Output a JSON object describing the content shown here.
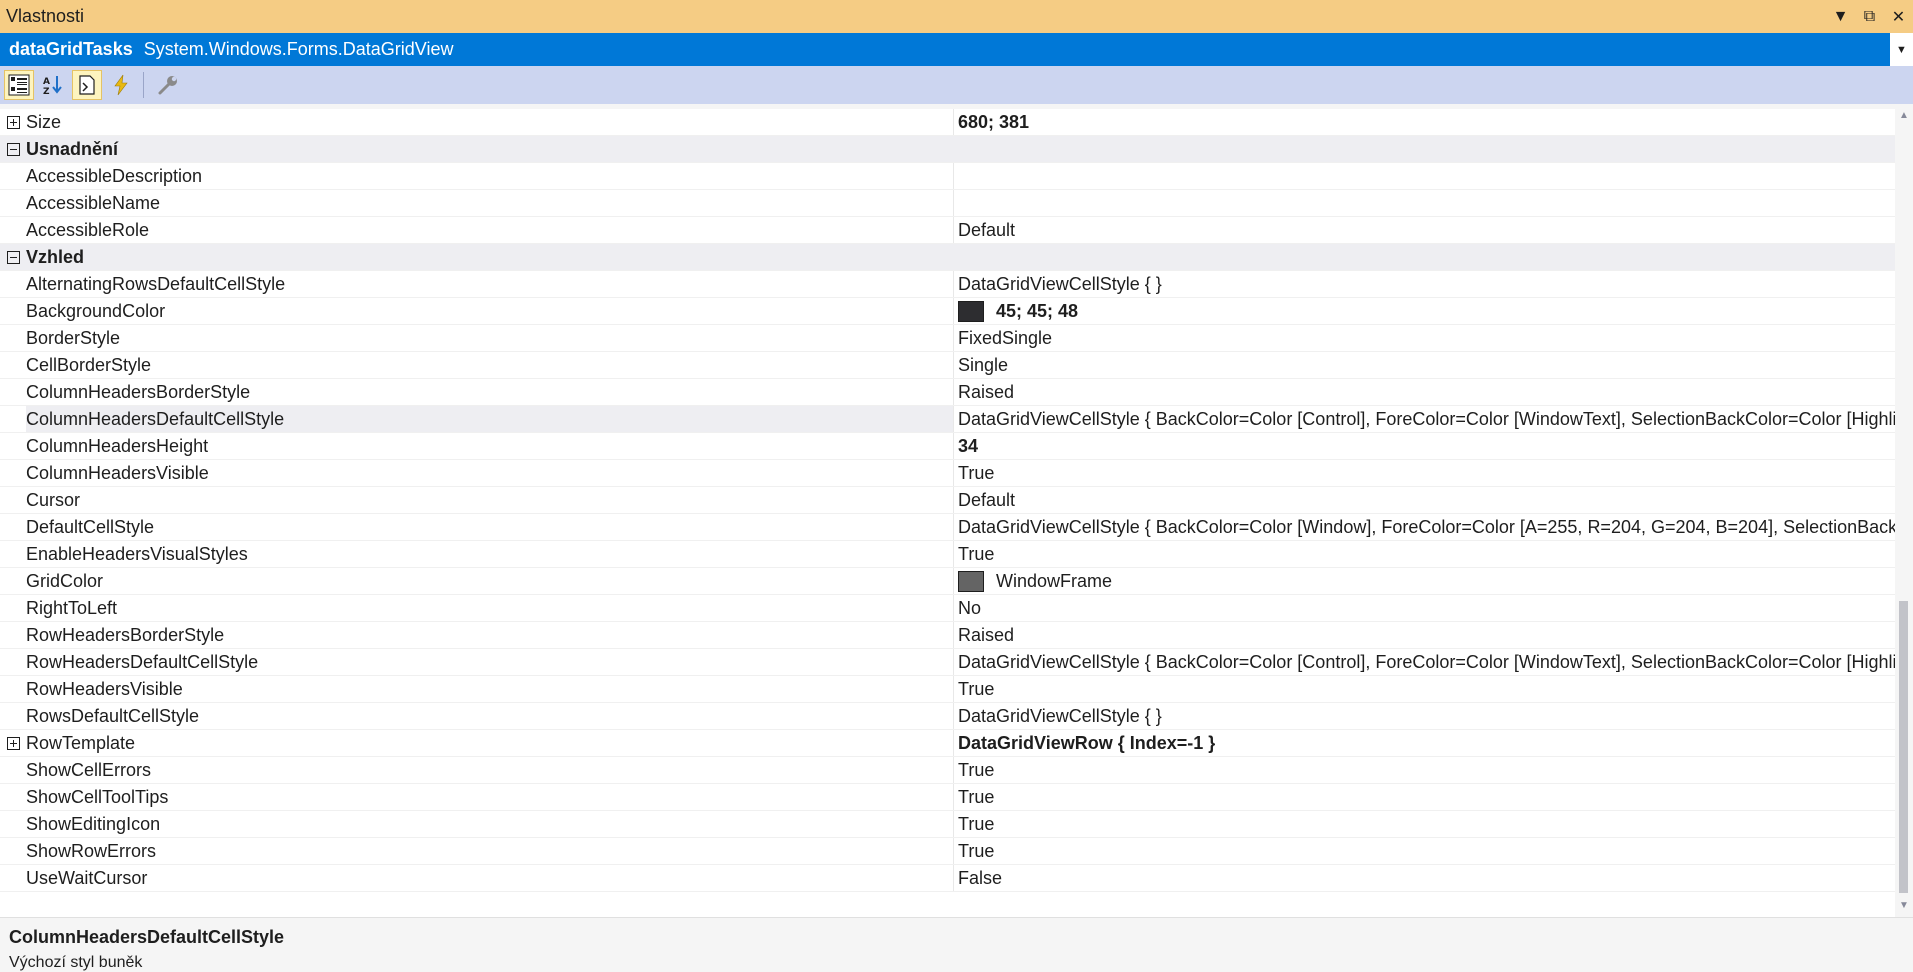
{
  "window": {
    "title": "Vlastnosti",
    "controls": [
      "▼",
      "⧉",
      "✕"
    ]
  },
  "object_selector": {
    "name": "dataGridTasks",
    "type": "System.Windows.Forms.DataGridView",
    "dropdown_glyph": "▼"
  },
  "toolbar": {
    "buttons": [
      {
        "name": "categorized-icon",
        "active": true
      },
      {
        "name": "alphabetical-icon",
        "active": false
      },
      {
        "name": "properties-icon",
        "active": true
      },
      {
        "name": "events-icon",
        "active": false
      },
      {
        "name": "property-pages-icon",
        "active": false
      }
    ]
  },
  "grid": {
    "rows": [
      {
        "kind": "prop",
        "expander": "plus",
        "name": "Size",
        "value": "680; 381",
        "bold": true
      },
      {
        "kind": "cat",
        "expander": "minus",
        "name": "Usnadnění"
      },
      {
        "kind": "prop",
        "name": "AccessibleDescription",
        "value": ""
      },
      {
        "kind": "prop",
        "name": "AccessibleName",
        "value": ""
      },
      {
        "kind": "prop",
        "name": "AccessibleRole",
        "value": "Default"
      },
      {
        "kind": "cat",
        "expander": "minus",
        "name": "Vzhled"
      },
      {
        "kind": "prop",
        "name": "AlternatingRowsDefaultCellStyle",
        "value": "DataGridViewCellStyle { }"
      },
      {
        "kind": "prop",
        "name": "BackgroundColor",
        "value": "45; 45; 48",
        "bold": true,
        "swatch": "#2D2D30"
      },
      {
        "kind": "prop",
        "name": "BorderStyle",
        "value": "FixedSingle"
      },
      {
        "kind": "prop",
        "name": "CellBorderStyle",
        "value": "Single"
      },
      {
        "kind": "prop",
        "name": "ColumnHeadersBorderStyle",
        "value": "Raised"
      },
      {
        "kind": "prop",
        "name": "ColumnHeadersDefaultCellStyle",
        "value": "DataGridViewCellStyle { BackColor=Color [Control], ForeColor=Color [WindowText], SelectionBackColor=Color [Highligh",
        "selected": true
      },
      {
        "kind": "prop",
        "name": "ColumnHeadersHeight",
        "value": "34",
        "bold": true
      },
      {
        "kind": "prop",
        "name": "ColumnHeadersVisible",
        "value": "True"
      },
      {
        "kind": "prop",
        "name": "Cursor",
        "value": "Default"
      },
      {
        "kind": "prop",
        "name": "DefaultCellStyle",
        "value": "DataGridViewCellStyle { BackColor=Color [Window], ForeColor=Color [A=255, R=204, G=204, B=204], SelectionBackCo"
      },
      {
        "kind": "prop",
        "name": "EnableHeadersVisualStyles",
        "value": "True"
      },
      {
        "kind": "prop",
        "name": "GridColor",
        "value": "WindowFrame",
        "swatch": "#646464"
      },
      {
        "kind": "prop",
        "name": "RightToLeft",
        "value": "No"
      },
      {
        "kind": "prop",
        "name": "RowHeadersBorderStyle",
        "value": "Raised"
      },
      {
        "kind": "prop",
        "name": "RowHeadersDefaultCellStyle",
        "value": "DataGridViewCellStyle { BackColor=Color [Control], ForeColor=Color [WindowText], SelectionBackColor=Color [Highligh"
      },
      {
        "kind": "prop",
        "name": "RowHeadersVisible",
        "value": "True"
      },
      {
        "kind": "prop",
        "name": "RowsDefaultCellStyle",
        "value": "DataGridViewCellStyle { }"
      },
      {
        "kind": "prop",
        "expander": "plus",
        "name": "RowTemplate",
        "value": "DataGridViewRow { Index=-1 }",
        "bold": true
      },
      {
        "kind": "prop",
        "name": "ShowCellErrors",
        "value": "True"
      },
      {
        "kind": "prop",
        "name": "ShowCellToolTips",
        "value": "True"
      },
      {
        "kind": "prop",
        "name": "ShowEditingIcon",
        "value": "True"
      },
      {
        "kind": "prop",
        "name": "ShowRowErrors",
        "value": "True"
      },
      {
        "kind": "prop",
        "name": "UseWaitCursor",
        "value": "False"
      }
    ]
  },
  "description": {
    "title": "ColumnHeadersDefaultCellStyle",
    "text": "Výchozí styl buněk"
  },
  "colors": {
    "title_bar": "#F5CC84",
    "selector": "#0078D7",
    "toolbar": "#CCD5F0",
    "category_row": "#EEEEF2"
  }
}
